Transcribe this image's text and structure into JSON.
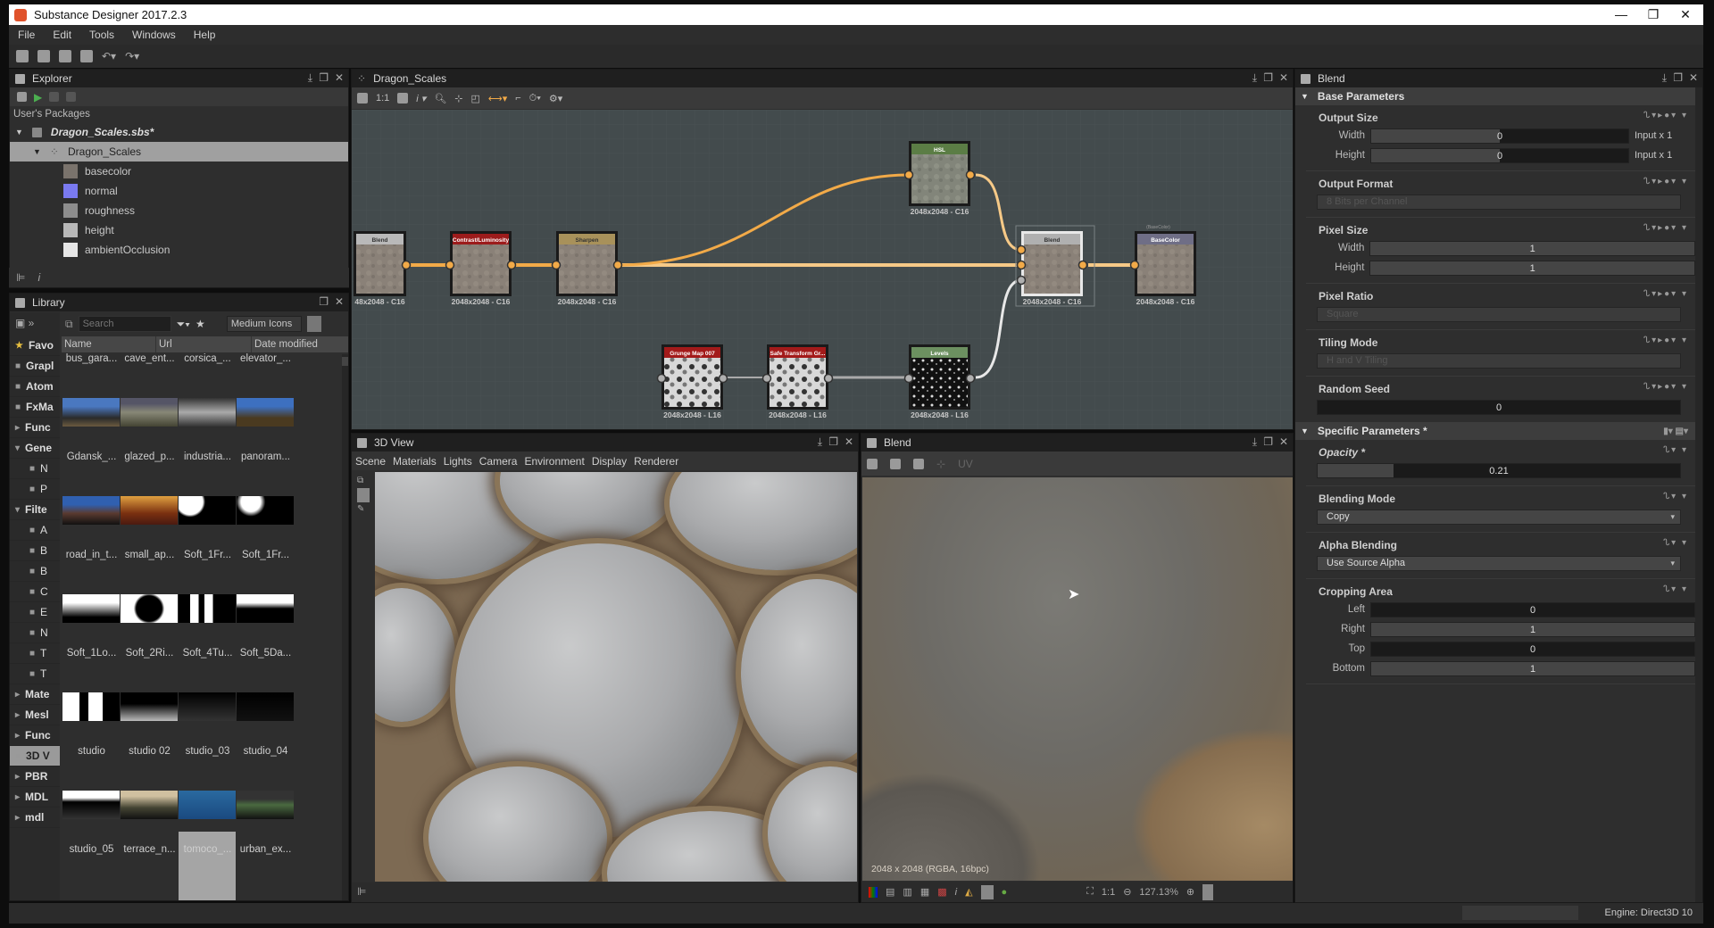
{
  "window": {
    "title": "Substance Designer 2017.2.3",
    "controls": [
      "—",
      "❐",
      "✕"
    ]
  },
  "menu": [
    "File",
    "Edit",
    "Tools",
    "Windows",
    "Help"
  ],
  "explorer": {
    "title": "Explorer",
    "section": "User's Packages",
    "package": "Dragon_Scales.sbs*",
    "graph": "Dragon_Scales",
    "outputs": [
      {
        "label": "basecolor",
        "color": "#7a736c"
      },
      {
        "label": "normal",
        "color": "#7a7af0"
      },
      {
        "label": "roughness",
        "color": "#8d8d8d"
      },
      {
        "label": "height",
        "color": "#b8b8b8"
      },
      {
        "label": "ambientOcclusion",
        "color": "#e6e6e6"
      }
    ]
  },
  "library": {
    "title": "Library",
    "search_placeholder": "Search",
    "view_mode": "Medium Icons",
    "columns": [
      "Name",
      "Url",
      "Date modified"
    ],
    "categories": [
      {
        "label": "Favo",
        "icon": "star-icon",
        "sub": false
      },
      {
        "label": "Grapl",
        "icon": "graph-icon",
        "sub": false
      },
      {
        "label": "Atom",
        "icon": "atomic-icon",
        "sub": false
      },
      {
        "label": "FxMa",
        "icon": "fxmap-icon",
        "sub": false
      },
      {
        "label": "Func",
        "icon": "expand-icon",
        "sub": false
      },
      {
        "label": "Gene",
        "icon": "collapse-icon",
        "sub": false
      },
      {
        "label": "N",
        "icon": "noise-icon",
        "sub": true
      },
      {
        "label": "P",
        "icon": "pattern-icon",
        "sub": true
      },
      {
        "label": "Filte",
        "icon": "collapse-icon",
        "sub": false
      },
      {
        "label": "A",
        "icon": "adjust-icon",
        "sub": true
      },
      {
        "label": "B",
        "icon": "blend-icon",
        "sub": true
      },
      {
        "label": "B",
        "icon": "blur-icon",
        "sub": true
      },
      {
        "label": "C",
        "icon": "color-icon",
        "sub": true
      },
      {
        "label": "E",
        "icon": "effect-icon",
        "sub": true
      },
      {
        "label": "N",
        "icon": "normal-icon",
        "sub": true
      },
      {
        "label": "T",
        "icon": "tile-icon",
        "sub": true
      },
      {
        "label": "T",
        "icon": "transform-icon",
        "sub": true
      },
      {
        "label": "Mate",
        "icon": "expand-icon",
        "sub": false
      },
      {
        "label": "Mesl",
        "icon": "expand-icon",
        "sub": false
      },
      {
        "label": "Func",
        "icon": "expand-icon",
        "sub": false
      },
      {
        "label": "3D V",
        "icon": "view3d-icon",
        "sub": false,
        "selected": true
      },
      {
        "label": "PBR",
        "icon": "expand-icon",
        "sub": false
      },
      {
        "label": "MDL",
        "icon": "expand-icon",
        "sub": false
      },
      {
        "label": "mdl",
        "icon": "expand-icon",
        "sub": false
      }
    ],
    "items": [
      "bus_gara...",
      "cave_ent...",
      "corsica_...",
      "elevator_...",
      "Gdansk_...",
      "glazed_p...",
      "industria...",
      "panoram...",
      "road_in_t...",
      "small_ap...",
      "Soft_1Fr...",
      "Soft_1Fr...",
      "Soft_1Lo...",
      "Soft_2Ri...",
      "Soft_4Tu...",
      "Soft_5Da...",
      "studio",
      "studio 02",
      "studio_03",
      "studio_04",
      "studio_05",
      "terrace_n...",
      "tomoco_...",
      "urban_ex..."
    ],
    "selected_item": "tomoco_..."
  },
  "graph": {
    "title": "Dragon_Scales",
    "toolbar_label": "1:1",
    "nodes": [
      {
        "title": "Blend",
        "res": "48x2048 - C16",
        "color": "#b9b9b9"
      },
      {
        "title": "Contrast/Luminosity",
        "res": "2048x2048 - C16",
        "color": "#9c1b1b"
      },
      {
        "title": "Sharpen",
        "res": "2048x2048 - C16",
        "color": "#a8915a"
      },
      {
        "title": "HSL",
        "res": "2048x2048 - C16",
        "color": "#5b7d45"
      },
      {
        "title": "Blend",
        "res": "2048x2048 - C16",
        "color": "#b0b0b0"
      },
      {
        "title": "BaseColor",
        "res": "2048x2048 - C16",
        "color": "#6f6e86",
        "comment": "(BaseColor)"
      },
      {
        "title": "Grunge Map 007",
        "res": "2048x2048 - L16",
        "color": "#a31a1a"
      },
      {
        "title": "Safe Transform Gr...",
        "res": "2048x2048 - L16",
        "color": "#a31a1a"
      },
      {
        "title": "Levels",
        "res": "2048x2048 - L16",
        "color": "#6c9060"
      }
    ],
    "link_color": "#f2aa48"
  },
  "view3d": {
    "title": "3D View",
    "menu": [
      "Scene",
      "Materials",
      "Lights",
      "Camera",
      "Environment",
      "Display",
      "Renderer"
    ]
  },
  "view2d": {
    "title": "Blend",
    "toolbar_uv": "UV",
    "caption": "2048 x 2048 (RGBA, 16bpc)",
    "zoom_fit": "1:1",
    "zoom": "127.13%"
  },
  "properties": {
    "title": "Blend",
    "base_section": "Base Parameters",
    "output_size": {
      "label": "Output Size",
      "width_label": "Width",
      "height_label": "Height",
      "width": "0",
      "height": "0",
      "width_suffix": "Input x 1",
      "height_suffix": "Input x 1"
    },
    "output_format": {
      "label": "Output Format",
      "value": "8 Bits per Channel"
    },
    "pixel_size": {
      "label": "Pixel Size",
      "width_label": "Width",
      "height_label": "Height",
      "width": "1",
      "height": "1"
    },
    "pixel_ratio": {
      "label": "Pixel Ratio",
      "value": "Square"
    },
    "tiling_mode": {
      "label": "Tiling Mode",
      "value": "H and V Tiling"
    },
    "random_seed": {
      "label": "Random Seed",
      "value": "0"
    },
    "specific_section": "Specific Parameters *",
    "opacity": {
      "label": "Opacity *",
      "value": "0.21",
      "fraction": 0.21
    },
    "blending_mode": {
      "label": "Blending Mode",
      "value": "Copy"
    },
    "alpha_blending": {
      "label": "Alpha Blending",
      "value": "Use Source Alpha"
    },
    "cropping": {
      "label": "Cropping Area",
      "left_label": "Left",
      "right_label": "Right",
      "top_label": "Top",
      "bottom_label": "Bottom",
      "left": "0",
      "right": "1",
      "top": "0",
      "bottom": "1"
    }
  },
  "status": {
    "engine": "Engine: Direct3D 10"
  }
}
